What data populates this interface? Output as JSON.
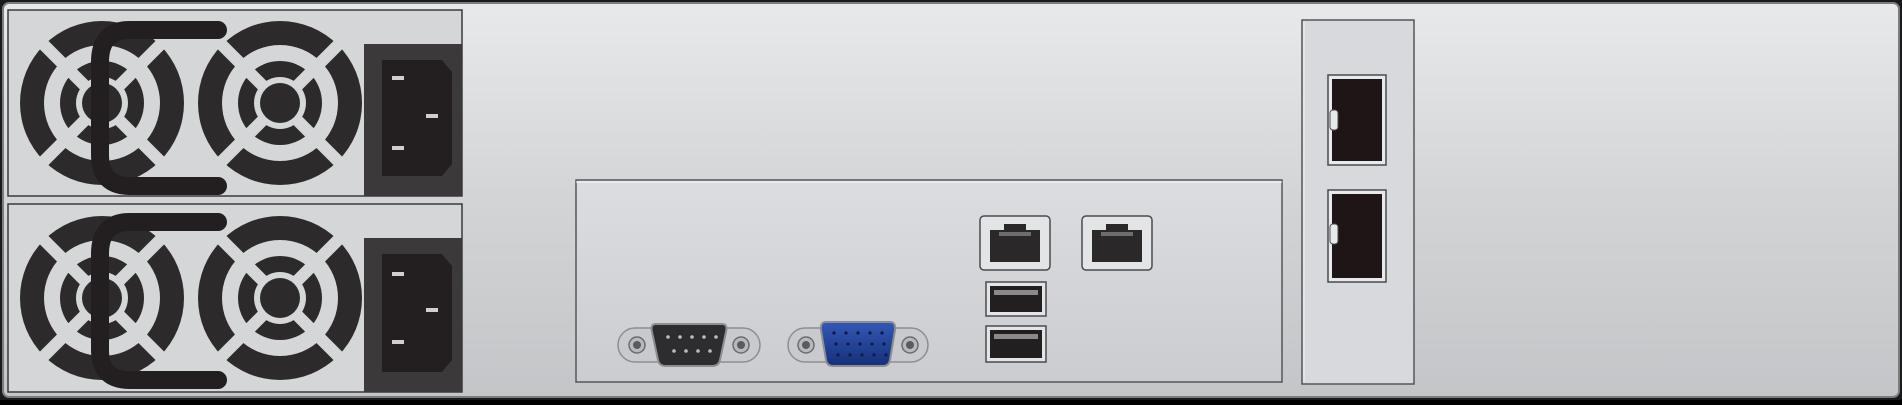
{
  "device": {
    "name": "",
    "chassis_color": "#d6d7d9",
    "dark_color": "#231f20",
    "vga_color": "#1f3f95"
  },
  "power_supplies": [
    {
      "id": "psu-1",
      "fans": 2,
      "inlet": "iec-c14"
    },
    {
      "id": "psu-2",
      "fans": 2,
      "inlet": "iec-c14"
    }
  ],
  "io_panel": {
    "ports": [
      {
        "type": "serial-db9",
        "name": "serial-port"
      },
      {
        "type": "vga-db15",
        "name": "vga-port"
      },
      {
        "type": "rj45",
        "name": "lan-port-1"
      },
      {
        "type": "rj45",
        "name": "lan-port-2"
      },
      {
        "type": "usb-a",
        "name": "usb-port-1"
      },
      {
        "type": "usb-a",
        "name": "usb-port-2"
      }
    ]
  },
  "expansion_slot": {
    "ports": [
      {
        "type": "sfp",
        "name": "sfp-port-1"
      },
      {
        "type": "sfp",
        "name": "sfp-port-2"
      }
    ]
  }
}
